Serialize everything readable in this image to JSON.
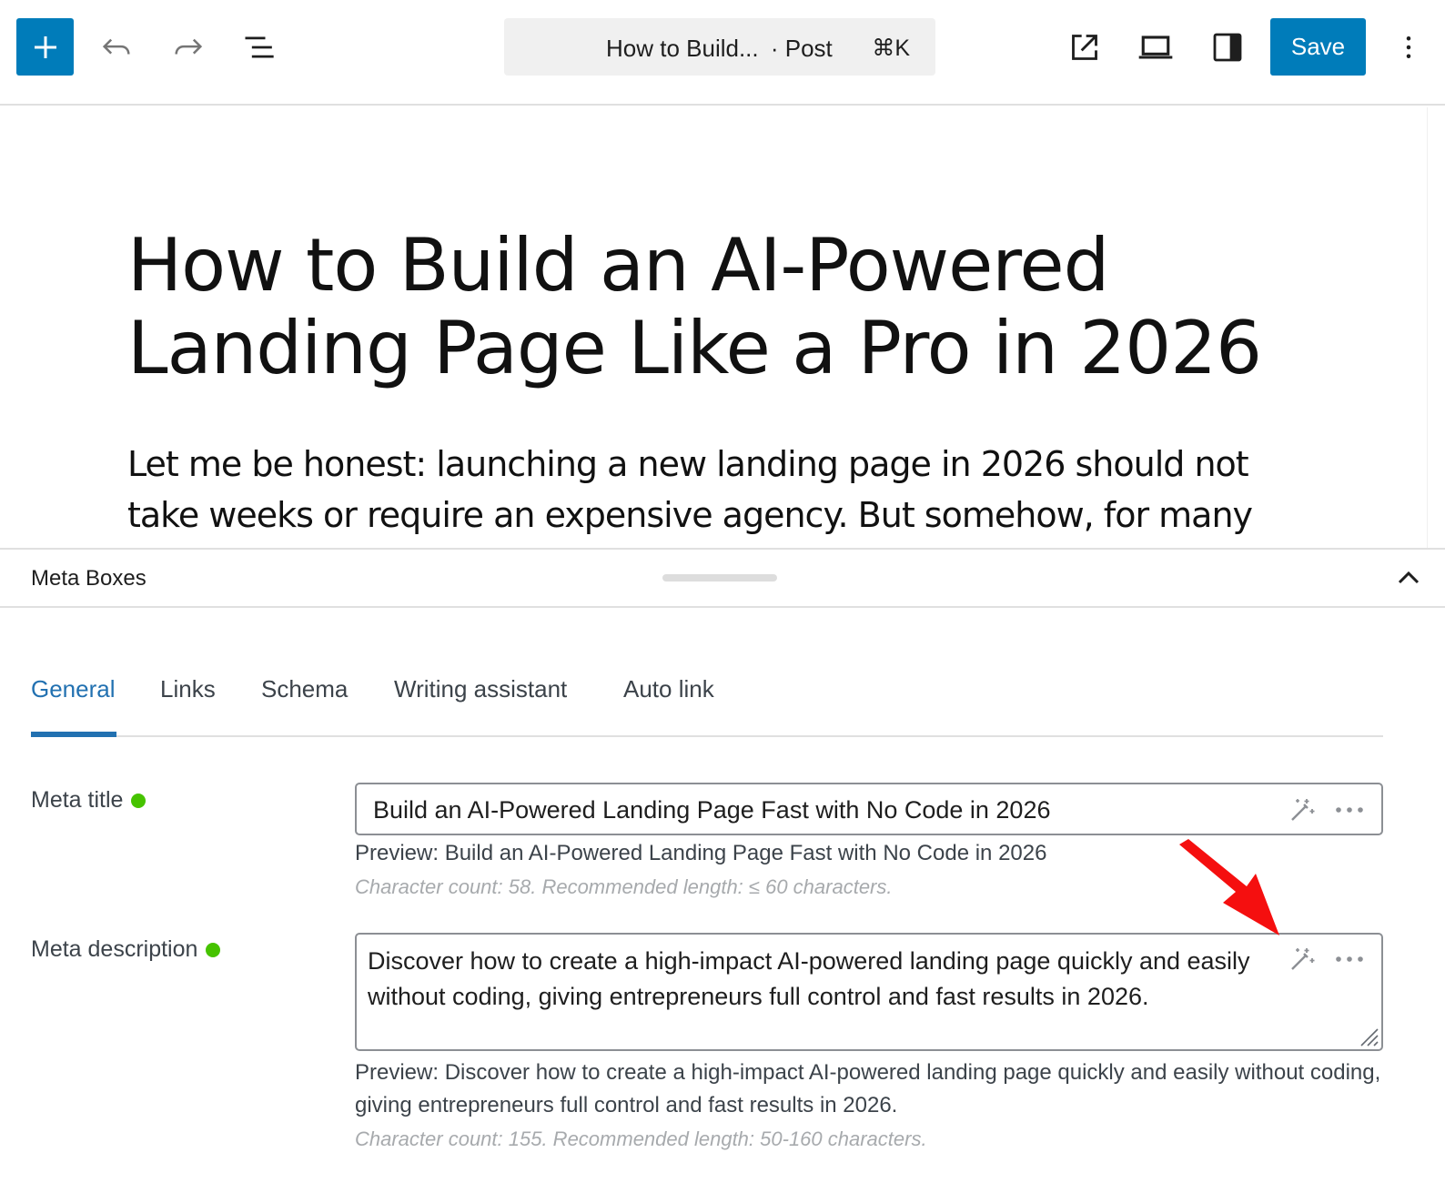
{
  "toolbar": {
    "command_title": "How to Build...",
    "command_type": "· Post",
    "command_shortcut": "⌘K",
    "save_label": "Save",
    "accent_color": "#007cba"
  },
  "post": {
    "title": "How to Build an AI-Powered Landing Page Like a Pro in 2026",
    "body": "Let me be honest: launching a new landing page in 2026 should not take weeks or require an expensive agency. But somehow, for many"
  },
  "meta_boxes": {
    "header_title": "Meta Boxes",
    "tabs": [
      {
        "label": "General",
        "active": true
      },
      {
        "label": "Links",
        "active": false
      },
      {
        "label": "Schema",
        "active": false
      },
      {
        "label": "Writing assistant",
        "active": false
      },
      {
        "label": "Auto link",
        "active": false
      }
    ],
    "meta_title": {
      "label": "Meta title",
      "status_color": "#46c300",
      "value": "Build an AI-Powered Landing Page Fast with No Code in 2026",
      "preview": "Preview: Build an AI-Powered Landing Page Fast with No Code in 2026",
      "count": "Character count: 58. Recommended length: ≤ 60 characters."
    },
    "meta_description": {
      "label": "Meta description",
      "status_color": "#46c300",
      "value": "Discover how to create a high-impact AI-powered landing page quickly and easily without coding, giving entrepreneurs full control and fast results in 2026.",
      "preview": "Preview: Discover how to create a high-impact AI-powered landing page quickly and easily without coding, giving entrepreneurs full control and fast results in 2026.",
      "count": "Character count: 155. Recommended length: 50-160 characters."
    }
  },
  "icons": {
    "add": "plus-icon",
    "undo": "undo-icon",
    "redo": "redo-icon",
    "list_view": "list-view-icon",
    "preview_link": "external-link-icon",
    "device_preview": "laptop-icon",
    "settings_sidebar": "sidebar-icon",
    "more": "vertical-ellipsis-icon",
    "collapse": "chevron-up-icon",
    "ai_generate": "magic-wand-icon",
    "options": "horizontal-ellipsis-icon",
    "annotation": "red-arrow-icon"
  }
}
